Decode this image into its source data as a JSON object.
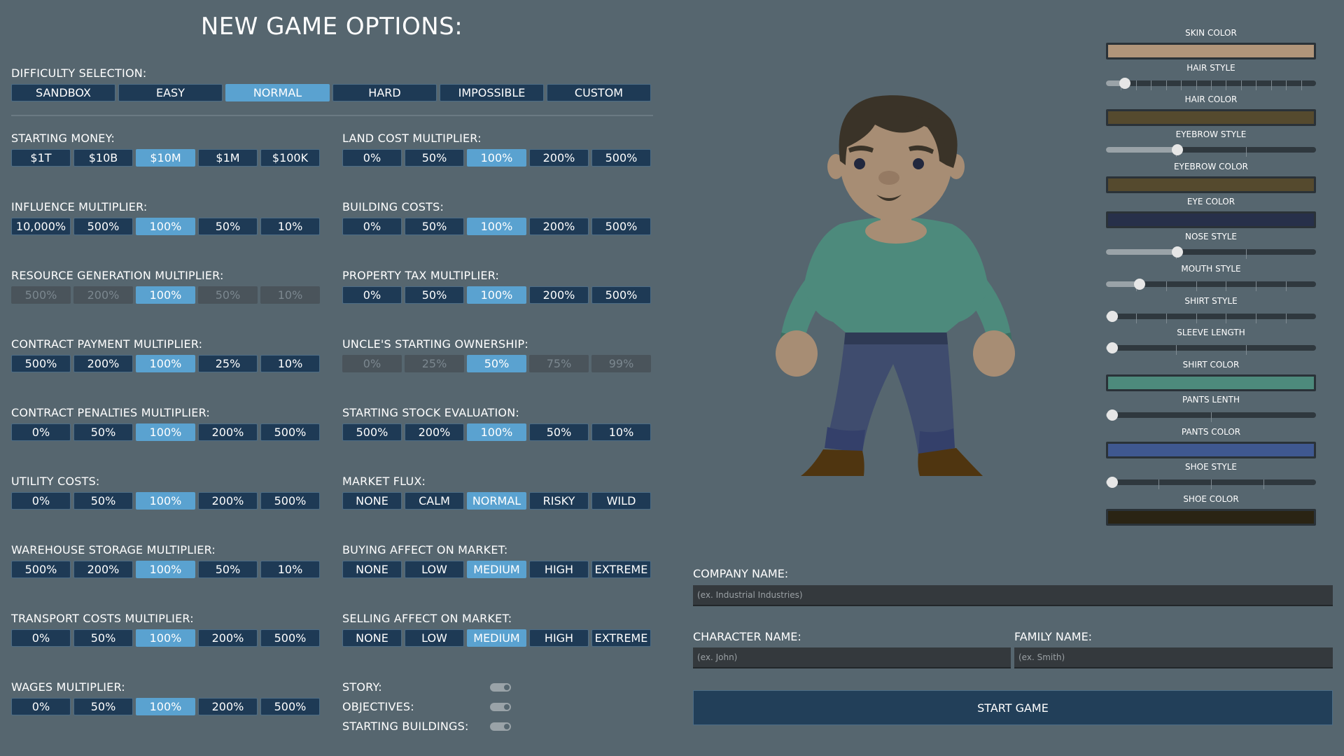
{
  "title": "NEW GAME OPTIONS:",
  "difficulty": {
    "label": "DIFFICULTY SELECTION:",
    "options": [
      "SANDBOX",
      "EASY",
      "NORMAL",
      "HARD",
      "IMPOSSIBLE",
      "CUSTOM"
    ],
    "selected": 2
  },
  "left_settings": [
    {
      "label": "STARTING MONEY:",
      "options": [
        "$1T",
        "$10B",
        "$10M",
        "$1M",
        "$100K"
      ],
      "selected": 2,
      "disabled": false
    },
    {
      "label": "INFLUENCE MULTIPLIER:",
      "options": [
        "10,000%",
        "500%",
        "100%",
        "50%",
        "10%"
      ],
      "selected": 2,
      "disabled": false
    },
    {
      "label": "RESOURCE GENERATION MULTIPLIER:",
      "options": [
        "500%",
        "200%",
        "100%",
        "50%",
        "10%"
      ],
      "selected": 2,
      "disabled": true
    },
    {
      "label": "CONTRACT PAYMENT MULTIPLIER:",
      "options": [
        "500%",
        "200%",
        "100%",
        "25%",
        "10%"
      ],
      "selected": 2,
      "disabled": false
    },
    {
      "label": "CONTRACT PENALTIES MULTIPLIER:",
      "options": [
        "0%",
        "50%",
        "100%",
        "200%",
        "500%"
      ],
      "selected": 2,
      "disabled": false
    },
    {
      "label": "UTILITY COSTS:",
      "options": [
        "0%",
        "50%",
        "100%",
        "200%",
        "500%"
      ],
      "selected": 2,
      "disabled": false
    },
    {
      "label": "WAREHOUSE STORAGE MULTIPLIER:",
      "options": [
        "500%",
        "200%",
        "100%",
        "50%",
        "10%"
      ],
      "selected": 2,
      "disabled": false
    },
    {
      "label": "TRANSPORT COSTS MULTIPLIER:",
      "options": [
        "0%",
        "50%",
        "100%",
        "200%",
        "500%"
      ],
      "selected": 2,
      "disabled": false
    },
    {
      "label": "WAGES MULTIPLIER:",
      "options": [
        "0%",
        "50%",
        "100%",
        "200%",
        "500%"
      ],
      "selected": 2,
      "disabled": false
    }
  ],
  "right_settings": [
    {
      "label": "LAND COST MULTIPLIER:",
      "options": [
        "0%",
        "50%",
        "100%",
        "200%",
        "500%"
      ],
      "selected": 2,
      "disabled": false
    },
    {
      "label": "BUILDING COSTS:",
      "options": [
        "0%",
        "50%",
        "100%",
        "200%",
        "500%"
      ],
      "selected": 2,
      "disabled": false
    },
    {
      "label": "PROPERTY TAX MULTIPLIER:",
      "options": [
        "0%",
        "50%",
        "100%",
        "200%",
        "500%"
      ],
      "selected": 2,
      "disabled": false
    },
    {
      "label": "UNCLE'S STARTING OWNERSHIP:",
      "options": [
        "0%",
        "25%",
        "50%",
        "75%",
        "99%"
      ],
      "selected": 2,
      "disabled": true
    },
    {
      "label": "STARTING STOCK EVALUATION:",
      "options": [
        "500%",
        "200%",
        "100%",
        "50%",
        "10%"
      ],
      "selected": 2,
      "disabled": false
    },
    {
      "label": "MARKET FLUX:",
      "options": [
        "NONE",
        "CALM",
        "NORMAL",
        "RISKY",
        "WILD"
      ],
      "selected": 2,
      "disabled": false
    },
    {
      "label": "BUYING AFFECT ON MARKET:",
      "options": [
        "NONE",
        "LOW",
        "MEDIUM",
        "HIGH",
        "EXTREME"
      ],
      "selected": 2,
      "disabled": false
    },
    {
      "label": "SELLING AFFECT ON MARKET:",
      "options": [
        "NONE",
        "LOW",
        "MEDIUM",
        "HIGH",
        "EXTREME"
      ],
      "selected": 2,
      "disabled": false
    }
  ],
  "toggles": [
    {
      "label": "STORY:",
      "on": true
    },
    {
      "label": "OBJECTIVES:",
      "on": true
    },
    {
      "label": "STARTING BUILDINGS:",
      "on": true
    }
  ],
  "appearance": [
    {
      "label": "SKIN COLOR",
      "type": "color",
      "color": "#b0957a"
    },
    {
      "label": "HAIR STYLE",
      "type": "slider",
      "value": 0.09,
      "ticks": 14
    },
    {
      "label": "HAIR COLOR",
      "type": "color",
      "color": "#554a2e"
    },
    {
      "label": "EYEBROW STYLE",
      "type": "slider",
      "value": 0.34,
      "ticks": 3
    },
    {
      "label": "EYEBROW COLOR",
      "type": "color",
      "color": "#554a2e"
    },
    {
      "label": "EYE COLOR",
      "type": "color",
      "color": "#27304a"
    },
    {
      "label": "NOSE STYLE",
      "type": "slider",
      "value": 0.34,
      "ticks": 3
    },
    {
      "label": "MOUTH STYLE",
      "type": "slider",
      "value": 0.16,
      "ticks": 7
    },
    {
      "label": "SHIRT STYLE",
      "type": "slider",
      "value": 0.03,
      "ticks": 7
    },
    {
      "label": "SLEEVE LENGTH",
      "type": "slider",
      "value": 0.03,
      "ticks": 3
    },
    {
      "label": "SHIRT COLOR",
      "type": "color",
      "color": "#4d8a7c"
    },
    {
      "label": "PANTS LENTH",
      "type": "slider",
      "value": 0.03,
      "ticks": 2
    },
    {
      "label": "PANTS COLOR",
      "type": "color",
      "color": "#3f5890"
    },
    {
      "label": "SHOE STYLE",
      "type": "slider",
      "value": 0.03,
      "ticks": 4
    },
    {
      "label": "SHOE COLOR",
      "type": "color",
      "color": "#2a2414"
    }
  ],
  "form": {
    "company_label": "COMPANY NAME:",
    "company_placeholder": "(ex. Industrial Industries)",
    "character_label": "CHARACTER NAME:",
    "character_placeholder": "(ex. John)",
    "family_label": "FAMILY NAME:",
    "family_placeholder": "(ex. Smith)",
    "start_label": "START GAME"
  },
  "colors": {
    "background": "#56666f",
    "button": "#1e3a55",
    "selected": "#5aa2d0",
    "disabled": "#4a545b"
  }
}
